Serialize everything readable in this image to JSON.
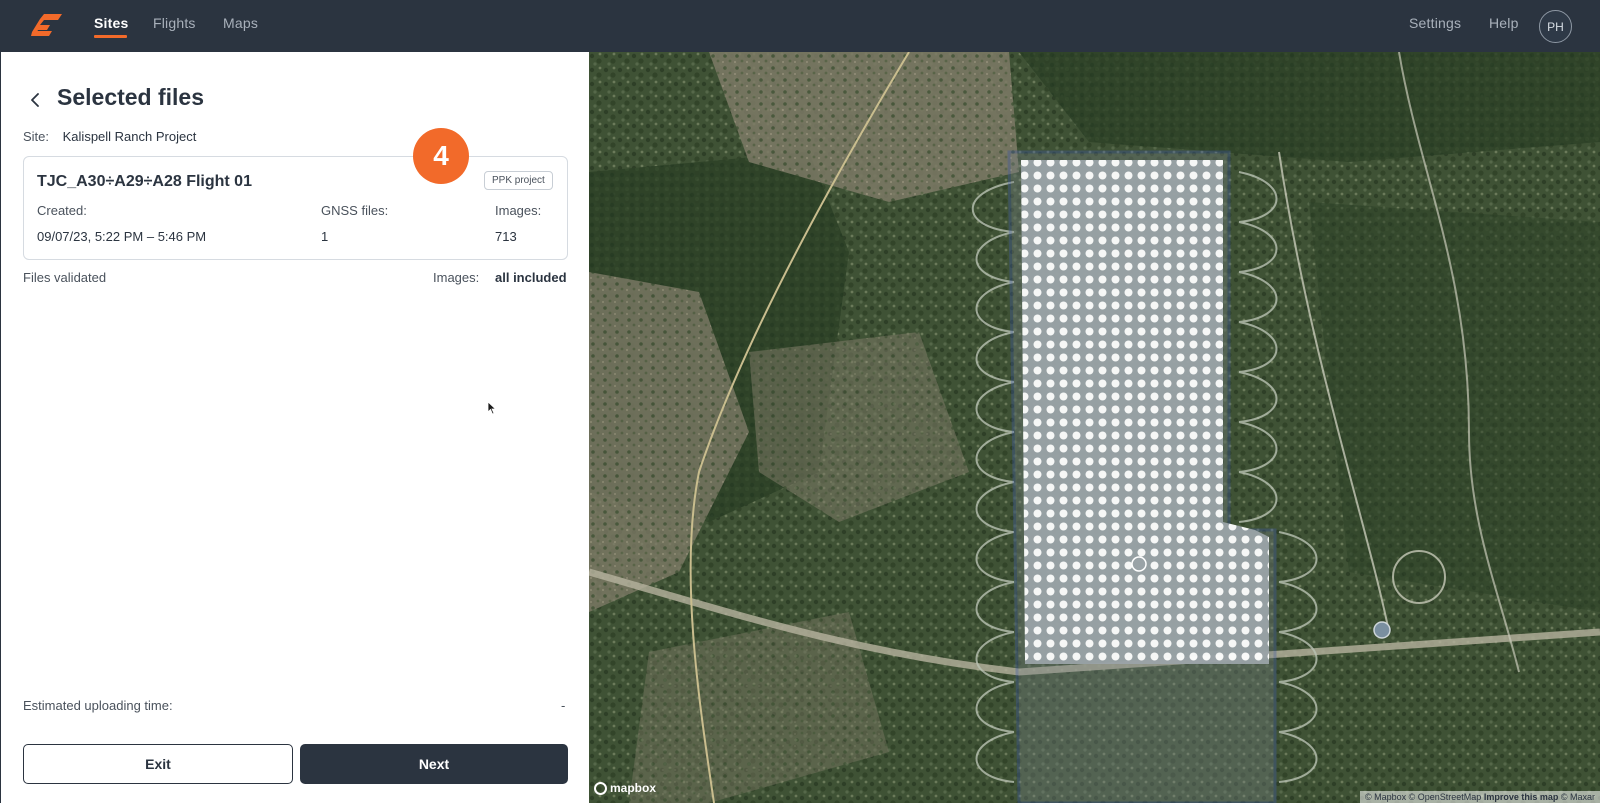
{
  "nav": {
    "items": [
      {
        "label": "Sites",
        "active": true
      },
      {
        "label": "Flights",
        "active": false
      },
      {
        "label": "Maps",
        "active": false
      }
    ],
    "settings_label": "Settings",
    "help_label": "Help",
    "avatar_initials": "PH"
  },
  "panel": {
    "title": "Selected files",
    "site_label": "Site:",
    "site_name": "Kalispell Ranch Project",
    "step_number": "4",
    "flight_card": {
      "title": "TJC_A30÷A29÷A28 Flight 01",
      "badge": "PPK project",
      "created_label": "Created:",
      "created_value": "09/07/23, 5:22 PM – 5:46 PM",
      "gnss_label": "GNSS files:",
      "gnss_value": "1",
      "images_label": "Images:",
      "images_value": "713"
    },
    "validation_status": "Files validated",
    "images_status_label": "Images:",
    "images_status_value": "all included",
    "estimated_label": "Estimated uploading time:",
    "estimated_value": "-",
    "exit_label": "Exit",
    "next_label": "Next"
  },
  "map": {
    "brand": "mapbox",
    "attribution_prefix": "© Mapbox © OpenStreetMap",
    "attribution_improve": "Improve this map",
    "attribution_suffix": "© Maxar"
  },
  "colors": {
    "topbar": "#2b3440",
    "accent": "#f26a2a",
    "primary_button": "#2b3440"
  }
}
